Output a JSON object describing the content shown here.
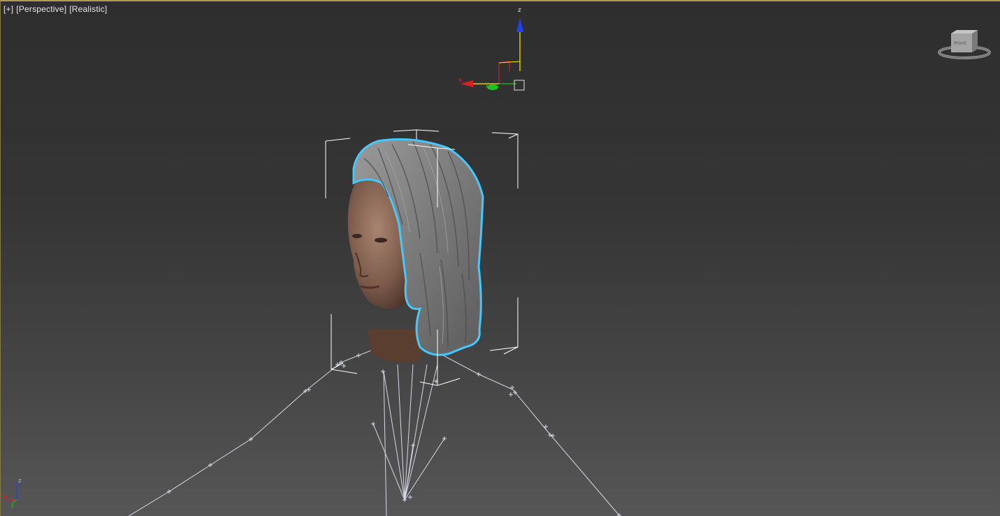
{
  "viewport": {
    "labels": {
      "plus": "[+]",
      "view": "[Perspective]",
      "shading": "[Realistic]"
    }
  },
  "gizmo": {
    "axes": {
      "z": "z",
      "x": "x",
      "y": "y"
    }
  },
  "corner_axes": {
    "z": "z",
    "x": "x",
    "y": "y"
  },
  "viewcube": {
    "face_label": "Front"
  },
  "colors": {
    "viewport_border": "#b39a52",
    "axis_x": "#e02020",
    "axis_y": "#20c020",
    "axis_z": "#2040ff",
    "selection_outline": "#44c8ff",
    "bone_lines": "#d8d8e8"
  }
}
